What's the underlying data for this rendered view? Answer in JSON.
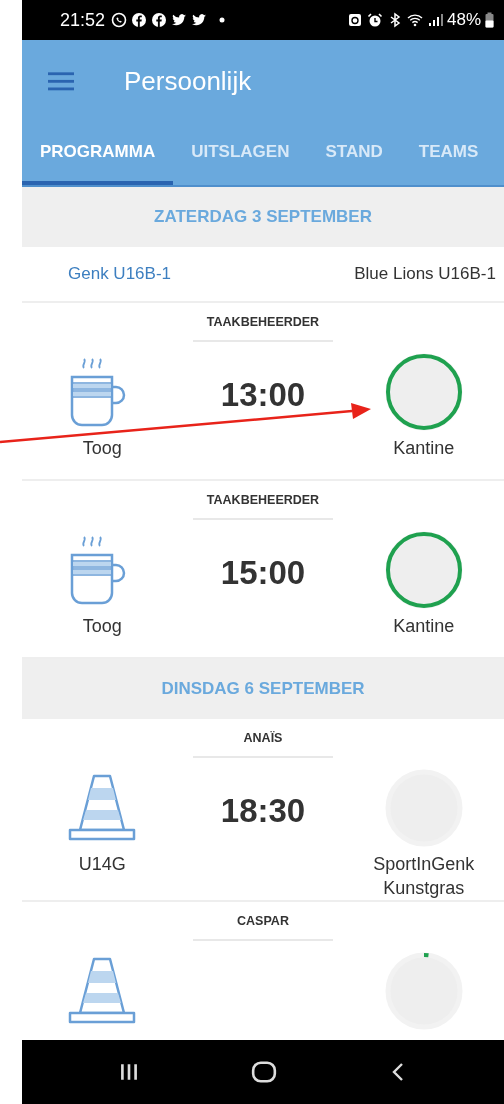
{
  "status_bar": {
    "time": "21:52",
    "battery": "48%"
  },
  "app_bar": {
    "title": "Persoonlijk"
  },
  "tabs": [
    {
      "label": "PROGRAMMA",
      "selected": true
    },
    {
      "label": "UITSLAGEN",
      "selected": false
    },
    {
      "label": "STAND",
      "selected": false
    },
    {
      "label": "TEAMS",
      "selected": false
    }
  ],
  "days": [
    {
      "date": "ZATERDAG 3 SEPTEMBER",
      "match": {
        "home": "Genk U16B-1",
        "away": "Blue Lions U16B-1"
      },
      "tasks": [
        {
          "role": "TAAKBEHEERDER",
          "kind": "cup",
          "time": "13:00",
          "left_label": "Toog",
          "right_label": "Kantine",
          "level": 1
        },
        {
          "role": "TAAKBEHEERDER",
          "kind": "cup",
          "time": "15:00",
          "left_label": "Toog",
          "right_label": "Kantine",
          "level": 1
        }
      ]
    },
    {
      "date": "DINSDAG 6 SEPTEMBER",
      "tasks": [
        {
          "role": "ANAÏS",
          "kind": "cone",
          "time": "18:30",
          "left_label": "U14G",
          "right_label": "SportInGenk Kunstgras",
          "level": 0
        },
        {
          "role": "CASPAR",
          "kind": "cone",
          "level": 0.02
        }
      ]
    }
  ]
}
